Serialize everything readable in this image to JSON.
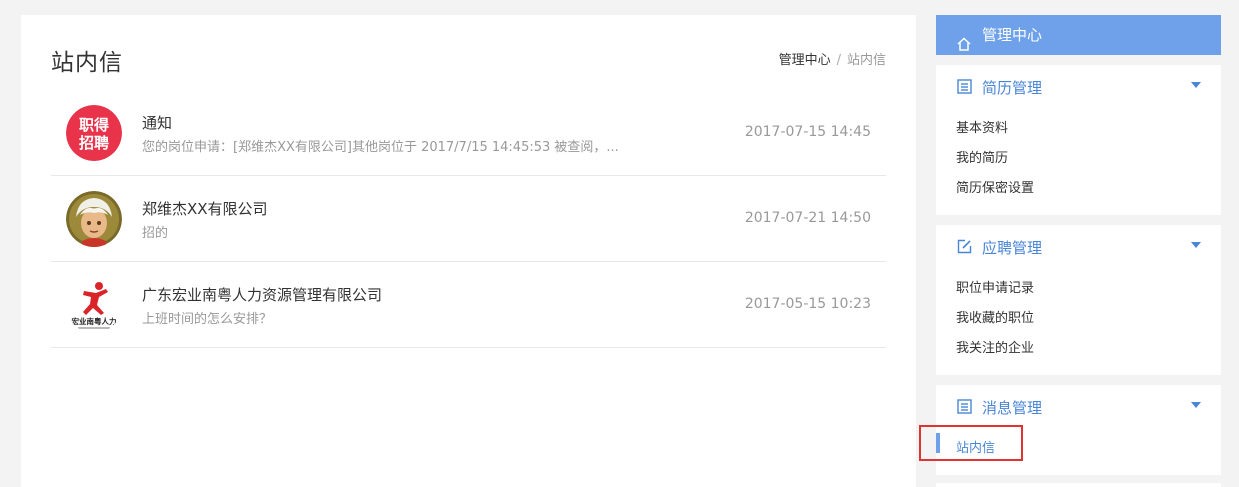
{
  "page": {
    "title": "站内信"
  },
  "breadcrumb": {
    "home": "管理中心",
    "separator": "/",
    "current": "站内信"
  },
  "messages": [
    {
      "title": "通知",
      "preview": "您的岗位申请：[郑维杰XX有限公司]其他岗位于 2017/7/15 14:45:53 被查阅，...",
      "time": "2017-07-15 14:45",
      "avatar": "zhidezhaopin-logo"
    },
    {
      "title": "郑维杰XX有限公司",
      "preview": "招的",
      "time": "2017-07-21 14:50",
      "avatar": "cartoon-person-avatar"
    },
    {
      "title": "广东宏业南粤人力资源管理有限公司",
      "preview": "上班时间的怎么安排？",
      "time": "2017-05-15 10:23",
      "avatar": "running-man-logo"
    }
  ],
  "sidebar": {
    "header": {
      "label": "管理中心",
      "icon": "home-icon"
    },
    "sections": [
      {
        "title": "简历管理",
        "icon": "resume-icon",
        "items": [
          "基本资料",
          "我的简历",
          "简历保密设置"
        ]
      },
      {
        "title": "应聘管理",
        "icon": "edit-icon",
        "items": [
          "职位申请记录",
          "我收藏的职位",
          "我关注的企业"
        ]
      },
      {
        "title": "消息管理",
        "icon": "message-icon",
        "items": [
          "站内信"
        ]
      }
    ]
  },
  "colors": {
    "accent": "#6ea1ea",
    "link": "#4a85d6",
    "highlight": "#e03333"
  }
}
